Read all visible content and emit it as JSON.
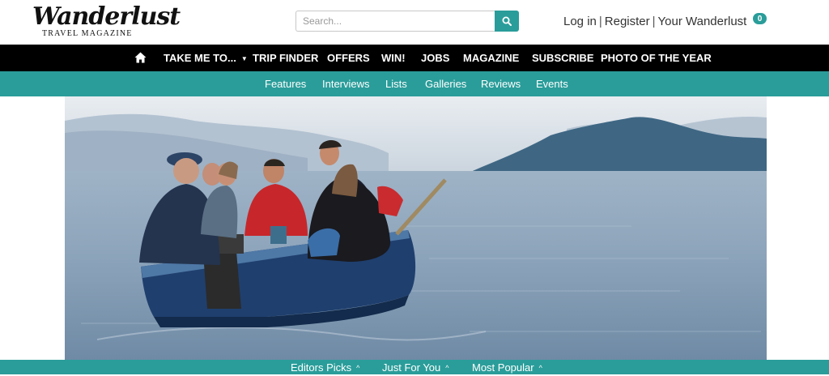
{
  "brand": {
    "logo_text": "Wanderlust",
    "tagline": "TRAVEL MAGAZINE"
  },
  "search": {
    "placeholder": "Search...",
    "icon": "search-icon"
  },
  "account": {
    "login": "Log in",
    "separator": "|",
    "register": "Register",
    "your_wanderlust": "Your Wanderlust",
    "badge_count": "0"
  },
  "main_nav": {
    "home_icon": "home-icon",
    "items": [
      {
        "label": "TAKE ME TO..."
      },
      {
        "label": "TRIP FINDER"
      },
      {
        "label": "OFFERS"
      },
      {
        "label": "WIN!"
      },
      {
        "label": "JOBS"
      },
      {
        "label": "MAGAZINE"
      },
      {
        "label": "SUBSCRIBE"
      },
      {
        "label": "PHOTO OF THE YEAR"
      }
    ]
  },
  "sub_nav": {
    "items": [
      {
        "label": "Features"
      },
      {
        "label": "Interviews"
      },
      {
        "label": "Lists"
      },
      {
        "label": "Galleries"
      },
      {
        "label": "Reviews"
      },
      {
        "label": "Events"
      }
    ]
  },
  "bottom_bar": {
    "items": [
      {
        "label": "Editors Picks"
      },
      {
        "label": "Just For You"
      },
      {
        "label": "Most Popular"
      }
    ]
  },
  "colors": {
    "teal": "#2a9d9a",
    "nav_black": "#000000"
  }
}
